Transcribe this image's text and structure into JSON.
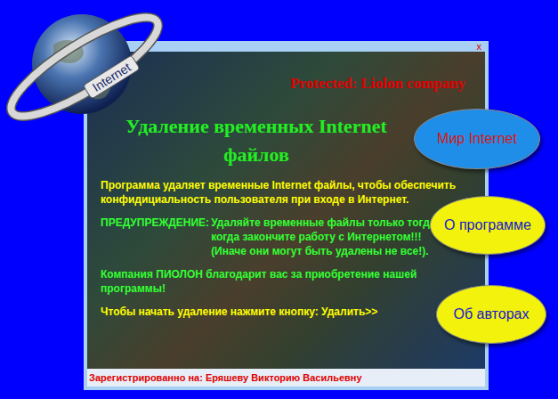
{
  "logo": {
    "label": "Internet"
  },
  "window": {
    "close": "x",
    "protection": "Protected: Liolon company",
    "title": "Удаление временных Internet файлов"
  },
  "paragraphs": [
    {
      "kind": "plain",
      "text": "Программа удаляет временные Internet файлы, чтобы обеспечить конфидициальность пользователя при входе в Интернет.",
      "color": "#ffff00"
    },
    {
      "kind": "warning",
      "label": "ПРЕДУПРЕЖДЕНИЕ:",
      "text": "Удаляйте временные файлы только тогда, когда закончите работу с Интернетом!!! (Иначе они могут быть удалены не все!).",
      "color": "#33ff33"
    },
    {
      "kind": "plain",
      "text": "Компания ПИОЛОН благодарит вас за приобретение нашей программы!",
      "color": "#33ff33"
    },
    {
      "kind": "plain",
      "text": "Чтобы начать удаление нажмите кнопку: Удалить>>",
      "color": "#ffff00"
    }
  ],
  "buttons": [
    {
      "label": "Мир Internet",
      "color": "#1e8ee8",
      "text_color": "#d81818"
    },
    {
      "label": "О программе",
      "color": "#f2f20c",
      "text_color": "#1818d0"
    },
    {
      "label": "Об авторах",
      "color": "#f2f20c",
      "text_color": "#1818d0"
    }
  ],
  "status_bar": {
    "text": "Зарегистрированно на: Еряшеву Викторию Васильевну"
  }
}
